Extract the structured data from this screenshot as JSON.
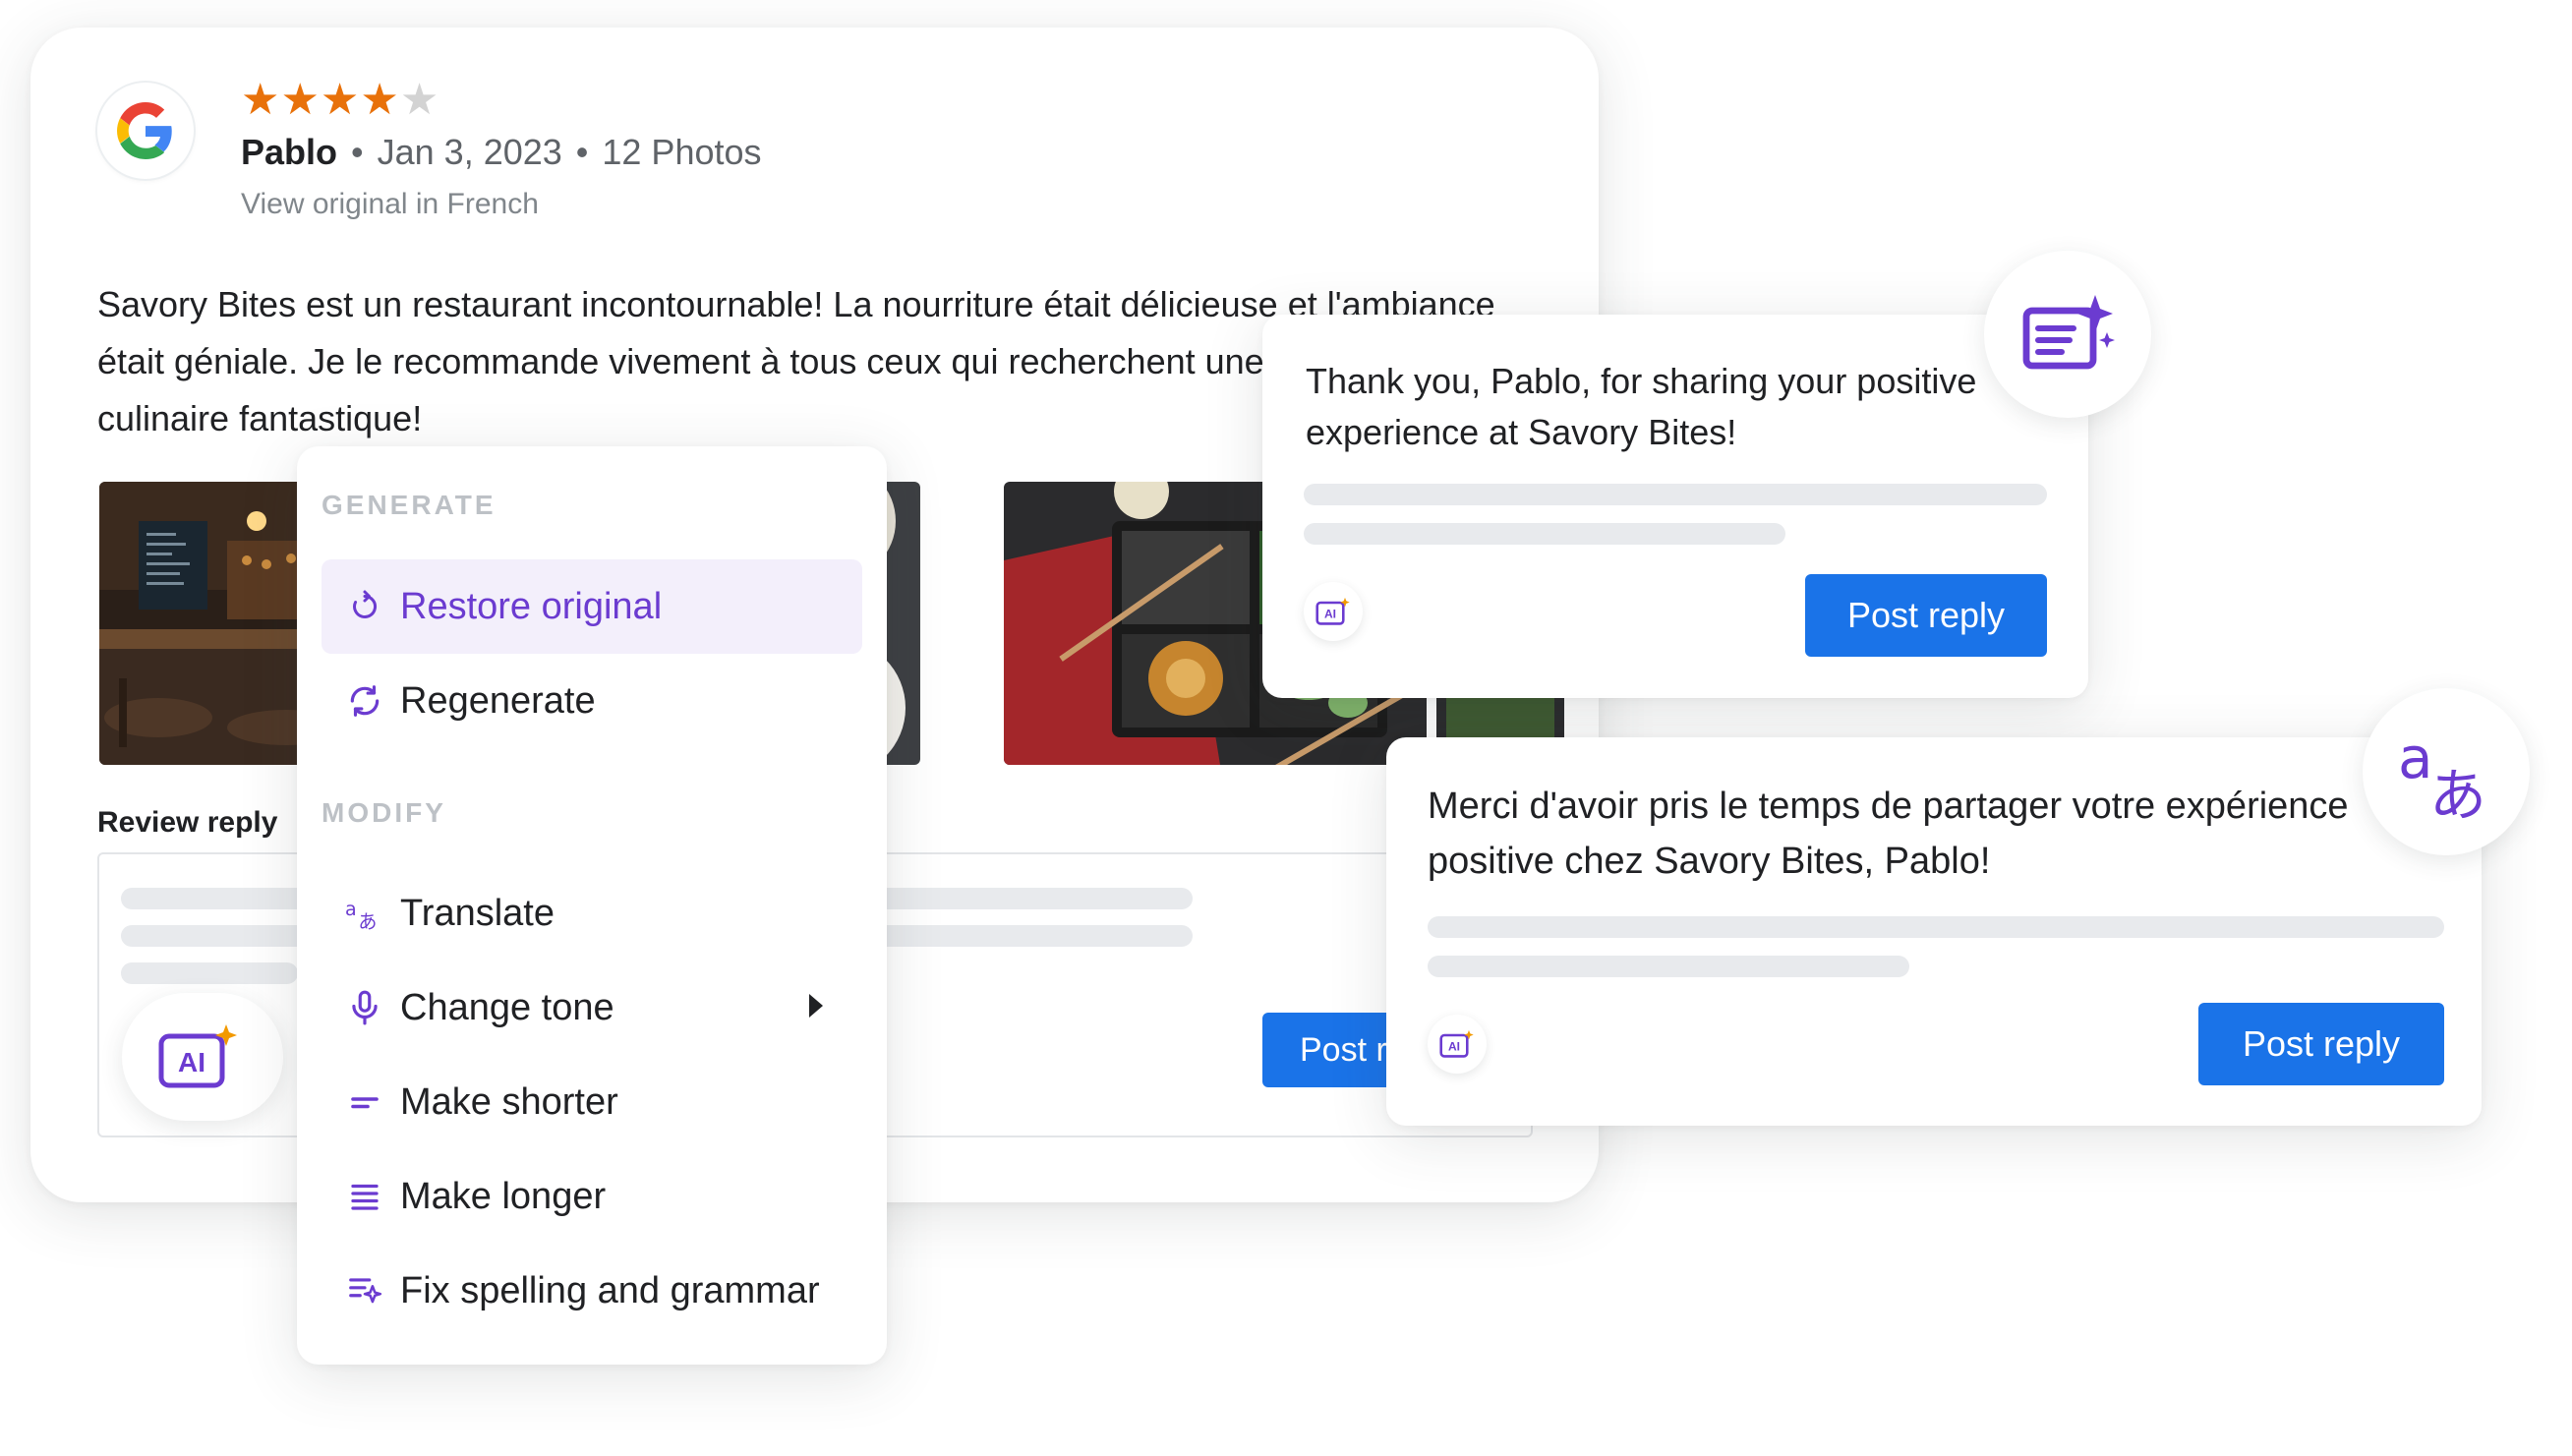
{
  "review": {
    "rating": 4,
    "rating_max": 5,
    "reviewer": "Pablo",
    "date": "Jan 3, 2023",
    "photos": "12 Photos",
    "view_original": "View original in French",
    "text": "Savory Bites est un restaurant incontournable! La nourriture était délicieuse et l'ambiance était géniale. Je le recommande vivement à tous ceux qui recherchent une expérience culinaire fantastique!",
    "reply_label": "Review reply",
    "post_button": "Post reply",
    "colors": {
      "star": "#e8710a",
      "star_empty": "#d3d3d3",
      "primary": "#1a73e8",
      "accent": "#6b3bd0"
    }
  },
  "menu": {
    "generate_heading": "GENERATE",
    "modify_heading": "MODIFY",
    "items": [
      {
        "label": "Restore original",
        "icon": "restore-icon",
        "selected": true
      },
      {
        "label": "Regenerate",
        "icon": "regenerate-icon"
      },
      {
        "label": "Translate",
        "icon": "translate-icon"
      },
      {
        "label": "Change tone",
        "icon": "tone-icon",
        "has_submenu": true
      },
      {
        "label": "Make shorter",
        "icon": "short-text-icon"
      },
      {
        "label": "Make longer",
        "icon": "long-text-icon"
      },
      {
        "label": "Fix spelling and grammar",
        "icon": "spellcheck-icon"
      }
    ]
  },
  "reply_en": {
    "text": "Thank you, Pablo, for sharing your positive experience at Savory Bites!",
    "post_button": "Post reply",
    "badge_icon": "ai-text-sparkle-icon"
  },
  "reply_fr": {
    "text": "Merci d'avoir pris le temps de partager votre expérience positive chez Savory Bites, Pablo!",
    "post_button": "Post reply",
    "badge_icon": "translate-icon"
  },
  "ai_icon_label": "AI"
}
